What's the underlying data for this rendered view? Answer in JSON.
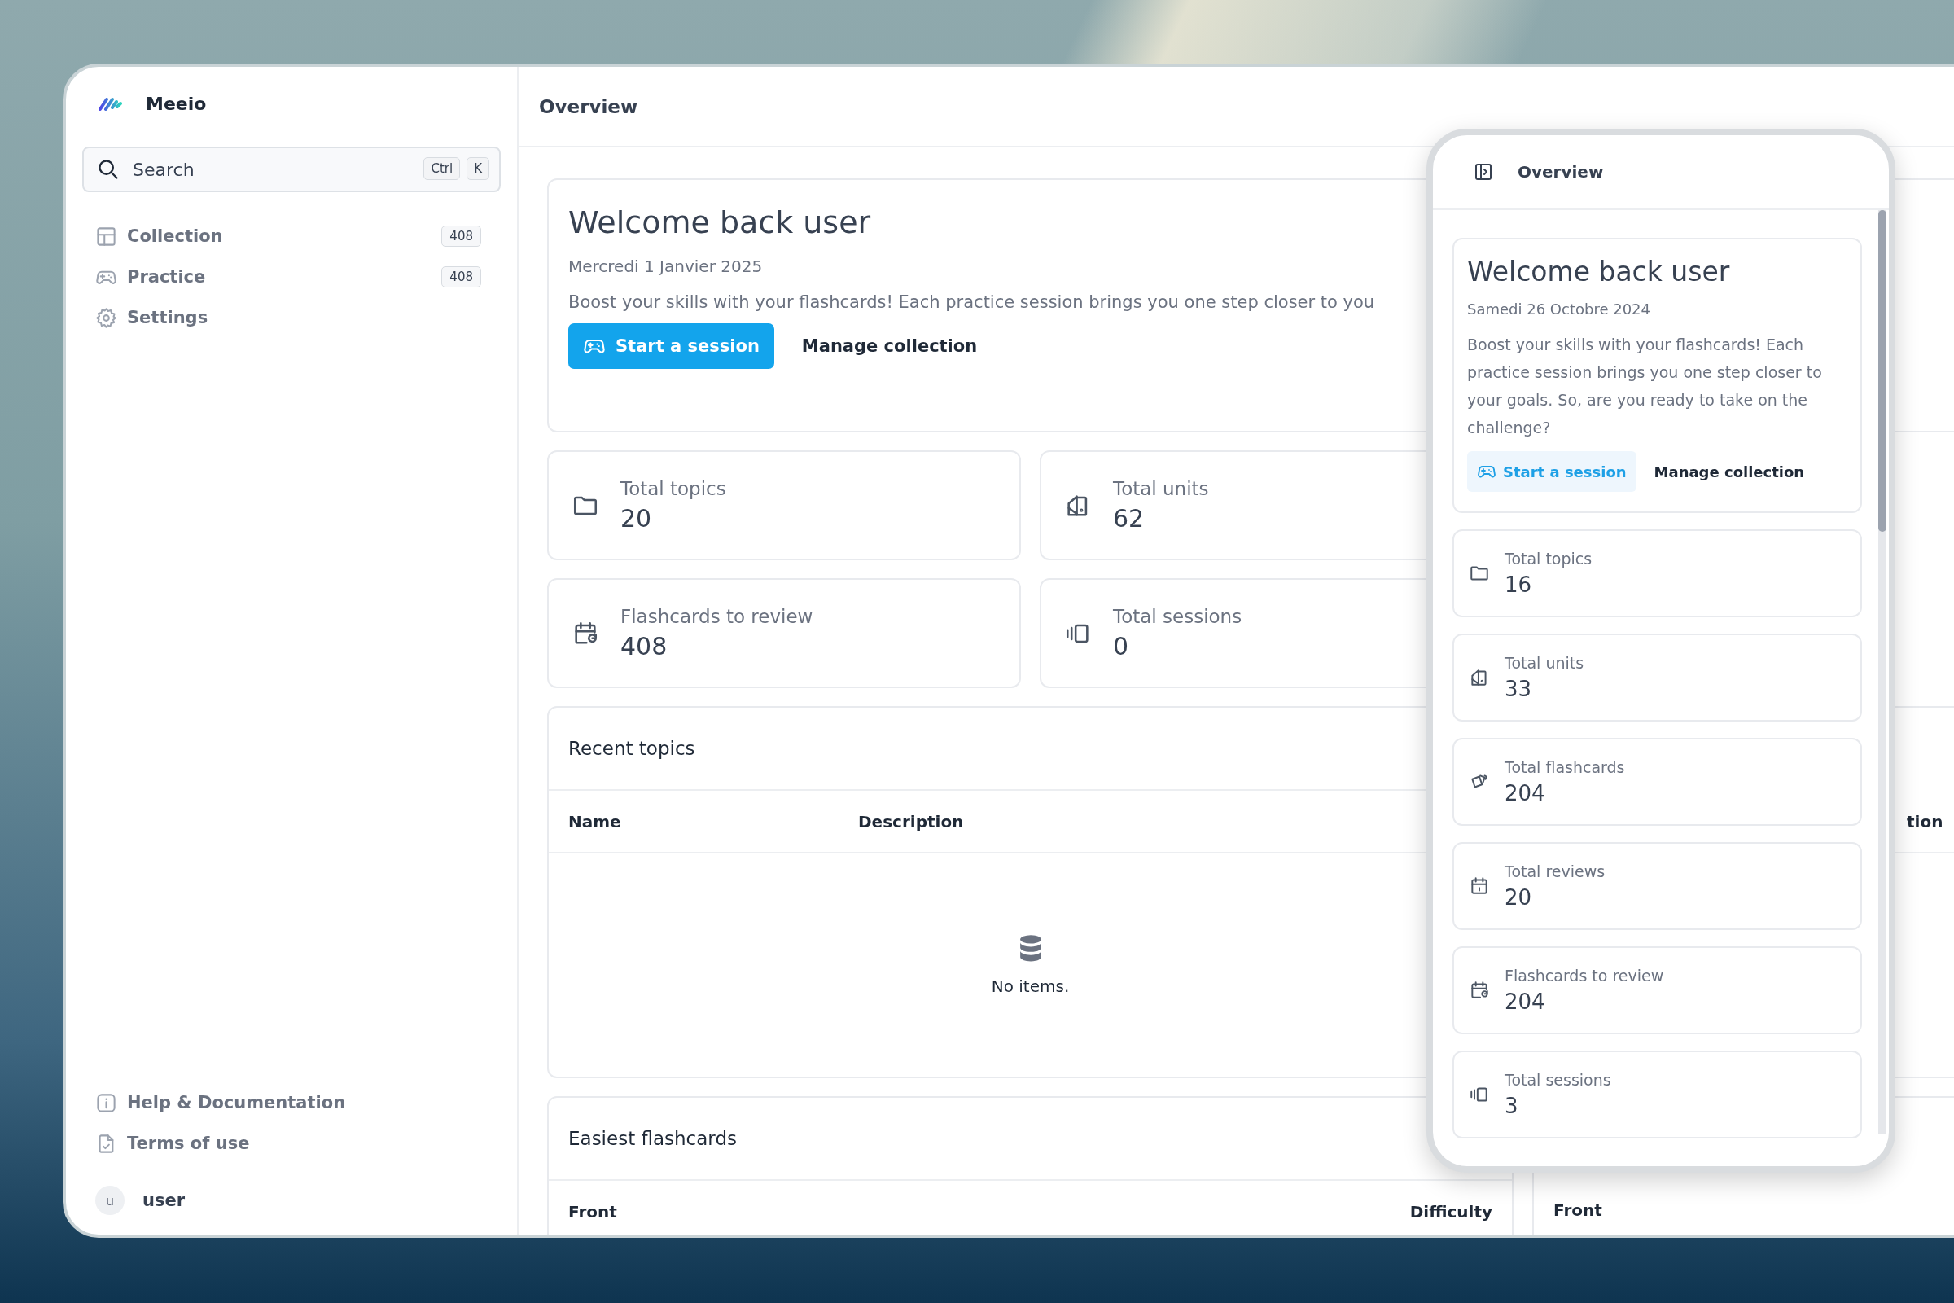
{
  "app": {
    "name": "Meeio"
  },
  "search": {
    "placeholder": "Search",
    "keys": [
      "Ctrl",
      "K"
    ]
  },
  "nav": [
    {
      "kind": "collection",
      "label": "Collection",
      "badge": "408"
    },
    {
      "kind": "practice",
      "label": "Practice",
      "badge": "408"
    },
    {
      "kind": "settings",
      "label": "Settings"
    }
  ],
  "footer_links": [
    {
      "kind": "help",
      "label": "Help & Documentation"
    },
    {
      "kind": "terms",
      "label": "Terms of use"
    }
  ],
  "user": {
    "initial": "u",
    "name": "user"
  },
  "header": {
    "title": "Overview"
  },
  "welcome": {
    "title": "Welcome back user",
    "date": "Mercredi 1 Janvier 2025",
    "message": "Boost your skills with your flashcards! Each practice session brings you one step closer to you",
    "primary_button": "Start a session",
    "secondary_button": "Manage collection"
  },
  "stats": [
    {
      "kind": "topics",
      "label": "Total topics",
      "value": "20"
    },
    {
      "kind": "units",
      "label": "Total units",
      "value": "62"
    },
    {
      "kind": "due",
      "label": "Flashcards to review",
      "value": "408"
    },
    {
      "kind": "sessions",
      "label": "Total sessions",
      "value": "0"
    }
  ],
  "recent_topics": {
    "title": "Recent topics",
    "columns": [
      "Name",
      "Description"
    ],
    "empty_text": "No items."
  },
  "side_table": {
    "columns": [
      "tion"
    ]
  },
  "easiest_flashcards": {
    "title": "Easiest flashcards",
    "columns": [
      "Front",
      "Difficulty"
    ]
  },
  "side_table_2": {
    "columns": [
      "Front"
    ]
  },
  "mobile": {
    "header": {
      "title": "Overview"
    },
    "welcome": {
      "title": "Welcome back user",
      "date": "Samedi 26 Octobre 2024",
      "message": "Boost your skills with your flashcards! Each practice session brings you one step closer to your goals. So, are you ready to take on the challenge?",
      "primary_button": "Start a session",
      "secondary_button": "Manage collection"
    },
    "stats": [
      {
        "kind": "topics",
        "label": "Total topics",
        "value": "16"
      },
      {
        "kind": "units",
        "label": "Total units",
        "value": "33"
      },
      {
        "kind": "flashcards",
        "label": "Total flashcards",
        "value": "204"
      },
      {
        "kind": "reviews",
        "label": "Total reviews",
        "value": "20"
      },
      {
        "kind": "due",
        "label": "Flashcards to review",
        "value": "204"
      },
      {
        "kind": "sessions",
        "label": "Total sessions",
        "value": "3"
      }
    ]
  }
}
